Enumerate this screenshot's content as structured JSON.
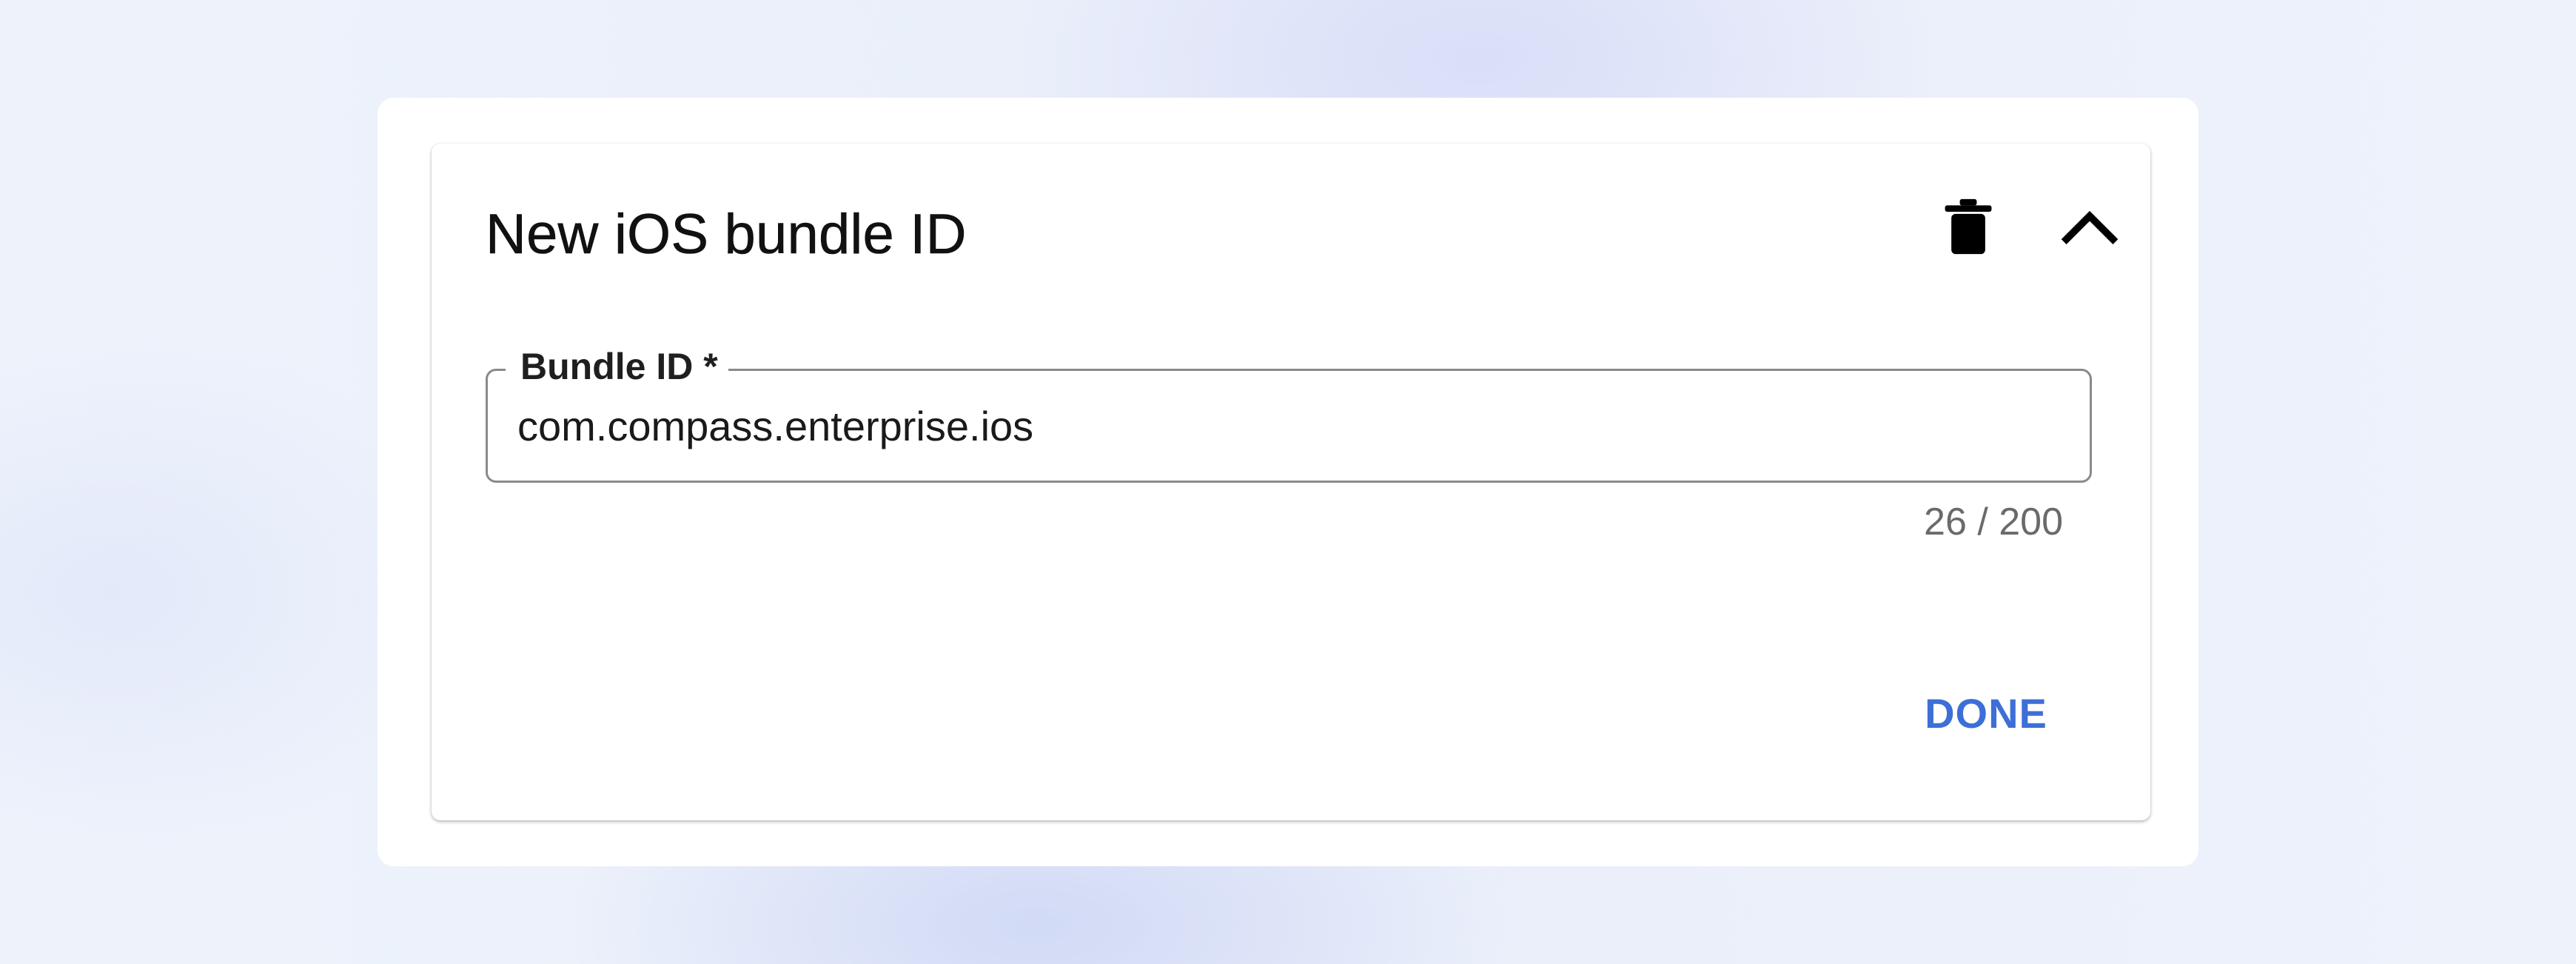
{
  "dialog": {
    "title": "New iOS bundle ID",
    "actions": {
      "delete_icon": "trash-icon",
      "collapse_icon": "chevron-up-icon"
    },
    "bundle_field": {
      "label": "Bundle ID *",
      "value": "com.compass.enterprise.ios",
      "counter": "26 / 200"
    },
    "done_label": "DONE"
  },
  "colors": {
    "accent": "#3d6fd6",
    "field_border": "#8a8a8a",
    "counter_text": "#6a6a6a"
  }
}
